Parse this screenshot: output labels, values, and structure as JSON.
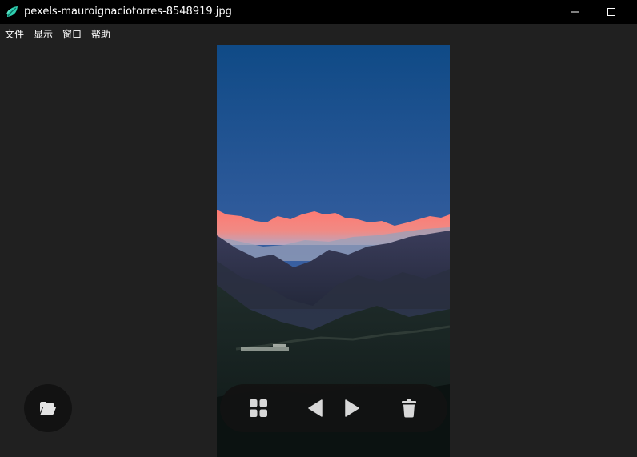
{
  "window": {
    "title": "pexels-mauroignaciotorres-8548919.jpg",
    "app_icon": "leaf-icon",
    "controls": [
      "minimize-icon",
      "maximize-icon"
    ]
  },
  "menu": {
    "items": [
      "文件",
      "显示",
      "窗口",
      "帮助"
    ]
  },
  "viewer": {
    "image_description_icon": "photo",
    "open_button_icon": "folder-open-icon"
  },
  "toolbar": {
    "buttons": [
      "grid-icon",
      "previous-icon",
      "next-icon",
      "delete-icon"
    ]
  },
  "colors": {
    "titlebar": "#000000",
    "background": "#202020",
    "accent": "#2fd0b0",
    "icon": "#d8d8d8"
  }
}
